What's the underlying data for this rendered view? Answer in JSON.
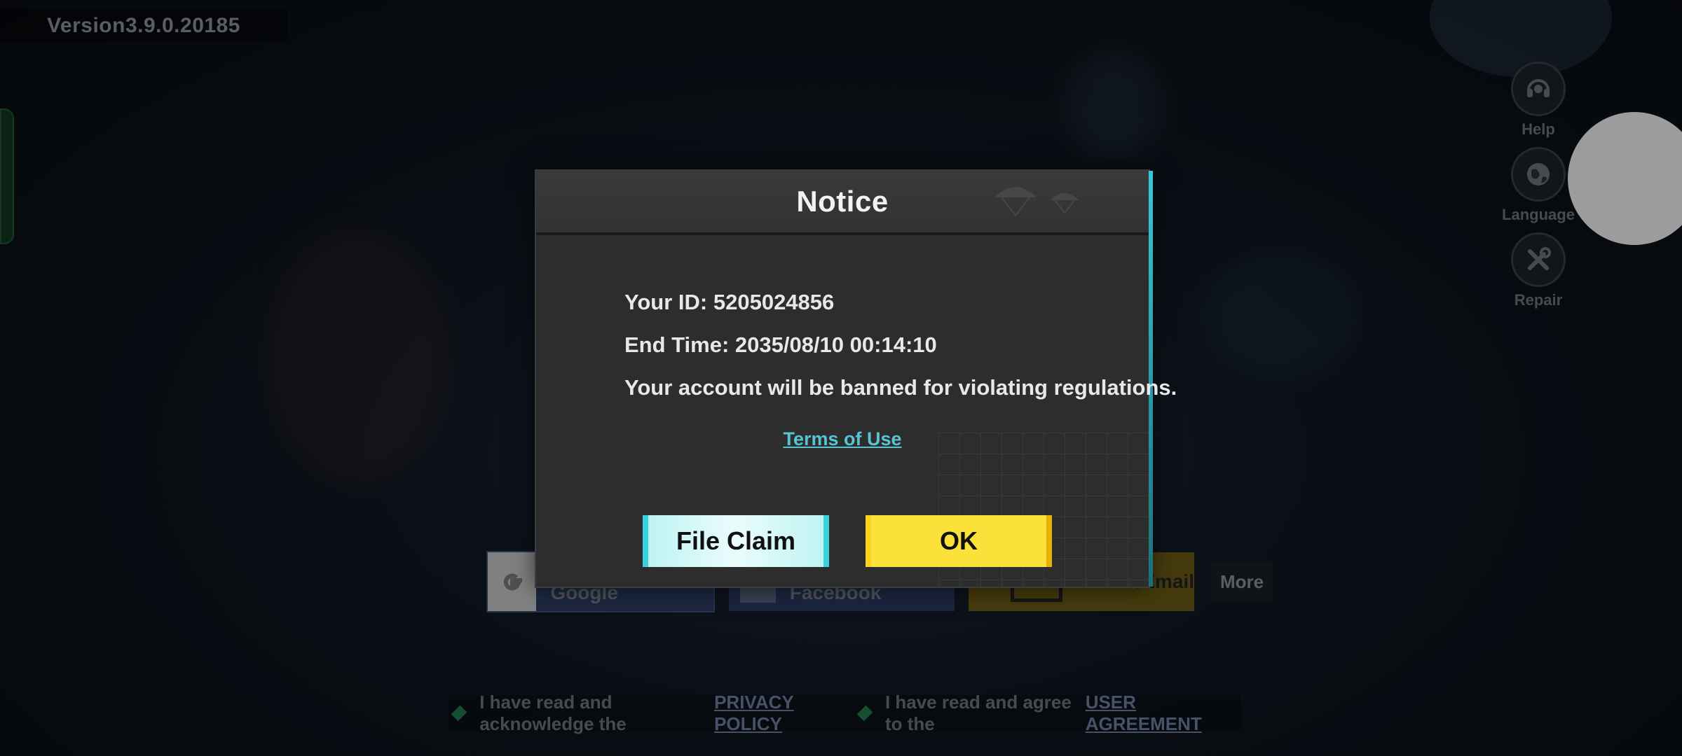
{
  "version": "Version3.9.0.20185",
  "tools": [
    {
      "label": "Help",
      "icon": "help-headset-icon"
    },
    {
      "label": "Language",
      "icon": "globe-icon"
    },
    {
      "label": "Repair",
      "icon": "wrench-icon"
    }
  ],
  "login": {
    "google_label": "Sign in with Google",
    "facebook_label": "Login with Facebook",
    "phone_label": "Phone/Email",
    "more_label": "More"
  },
  "agreement": {
    "privacy_text": "I have read and acknowledge the",
    "privacy_link": "PRIVACY POLICY",
    "user_text": "I have read and agree to the",
    "user_link": "USER AGREEMENT"
  },
  "dialog": {
    "title": "Notice",
    "id_line": "Your ID: 5205024856",
    "end_time_line": "End Time: 2035/08/10 00:14:10",
    "message": "Your account will be banned for violating regulations.",
    "terms_link": "Terms of Use",
    "file_claim_label": "File Claim",
    "ok_label": "OK"
  },
  "colors": {
    "accent_cyan": "#56c4d2",
    "ok_yellow": "#fbe13a",
    "dialog_bg": "#2d2d2e"
  }
}
